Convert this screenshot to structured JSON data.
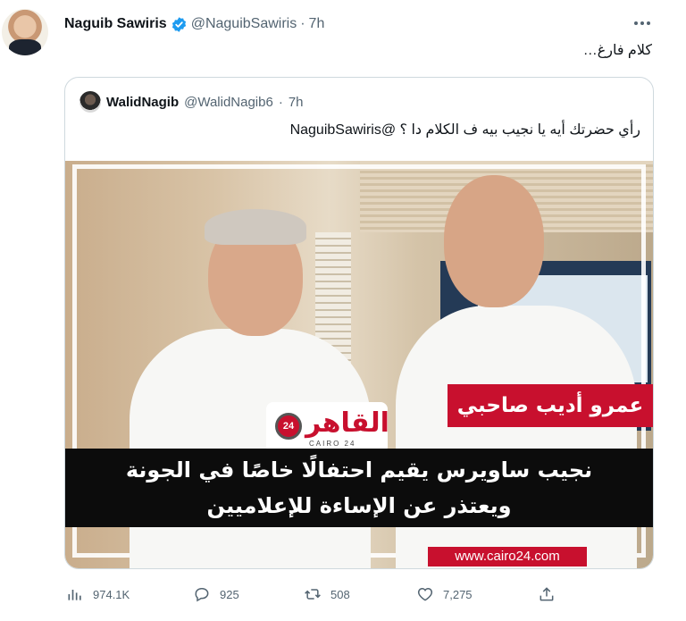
{
  "author": {
    "name": "Naguib Sawiris",
    "handle": "@NaguibSawiris",
    "separator": "·",
    "time": "7h",
    "text": "كلام فارغ…"
  },
  "quoted_tweet": {
    "name": "WalidNagib",
    "handle": "@WalidNagib6",
    "separator": "·",
    "time": "7h",
    "text": "رأي حضرتك أيه يا نجيب بيه ف الكلام دا ؟ @NaguibSawiris",
    "media": {
      "logo_text": "القاهر",
      "logo_badge": "24",
      "logo_sub": "CAIRO 24",
      "red_caption": "عمرو أديب صاحبي",
      "headline_line1": "نجيب ساويرس يقيم احتفالًا خاصًا في الجونة",
      "headline_line2": "ويعتذر عن الإساءة للإعلاميين",
      "url": "www.cairo24.com"
    }
  },
  "actions": {
    "views": "974.1K",
    "replies": "925",
    "retweets": "508",
    "likes": "7,275"
  },
  "colors": {
    "verified": "#1d9bf0",
    "muted": "#536471",
    "brand_red": "#c8102e"
  },
  "icons": [
    "more-icon",
    "verified-icon",
    "views-icon",
    "reply-icon",
    "retweet-icon",
    "like-icon",
    "share-icon"
  ]
}
